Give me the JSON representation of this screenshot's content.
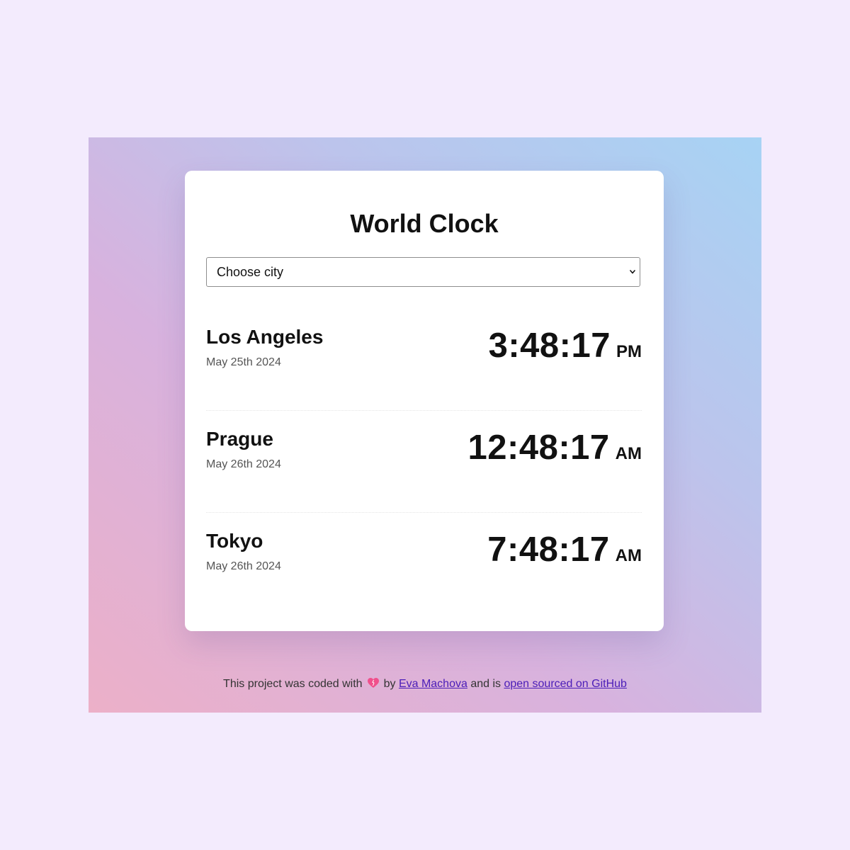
{
  "app": {
    "title": "World Clock"
  },
  "city_select": {
    "selected": "Choose city"
  },
  "cities": [
    {
      "name": "Los Angeles",
      "date": "May 25th 2024",
      "time": "3:48:17",
      "ampm": "PM"
    },
    {
      "name": "Prague",
      "date": "May 26th 2024",
      "time": "12:48:17",
      "ampm": "AM"
    },
    {
      "name": "Tokyo",
      "date": "May 26th 2024",
      "time": "7:48:17",
      "ampm": "AM"
    }
  ],
  "footer": {
    "prefix": "This project was coded with",
    "heart_icon": "heart-icon",
    "by": "by",
    "author_link": "Eva Machova",
    "middle": "and is",
    "github_link": "open sourced on GitHub"
  },
  "colors": {
    "page_background": "#f3ebfd",
    "gradient_start": "#ecb0c8",
    "gradient_end": "#a7d3f4",
    "link": "#4b1db8",
    "heart": "#f0508c"
  }
}
